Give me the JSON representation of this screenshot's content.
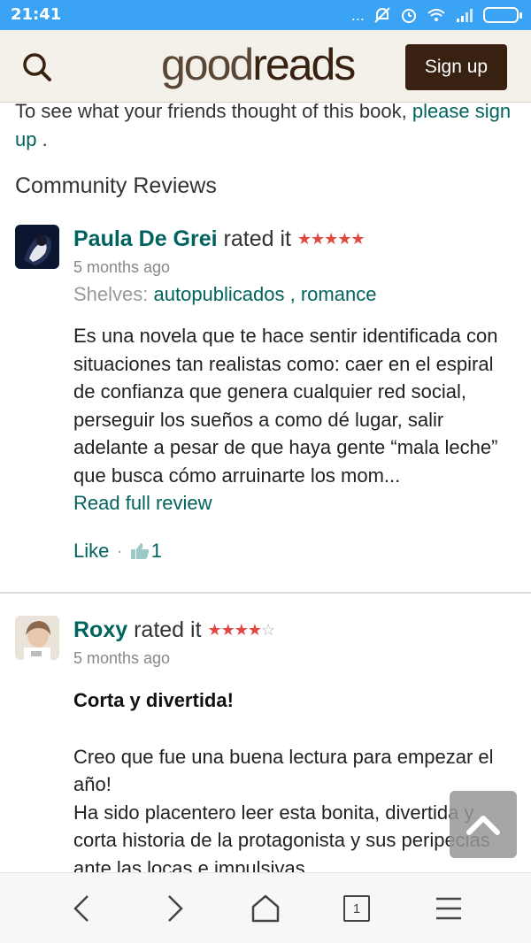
{
  "status_bar": {
    "time": "21:41",
    "dots": "..."
  },
  "header": {
    "logo_light": "good",
    "logo_bold": "reads",
    "signup_label": "Sign up"
  },
  "intro": {
    "text": "To see what your friends thought of this book, ",
    "link": "please sign up",
    "end": " ."
  },
  "section_title": "Community Reviews",
  "reviews": [
    {
      "name": "Paula De Grei",
      "rated": " rated it ",
      "rating": 5,
      "stars_full": "★★★★★",
      "stars_empty": "",
      "ago": "5 months ago",
      "shelves_label": "Shelves: ",
      "shelves": [
        "autopublicados",
        "romance"
      ],
      "shelves_sep": " , ",
      "text": "Es una novela que te hace sentir identificada con situaciones tan realistas como: caer en el espiral de confianza que genera cualquier red social, perseguir los sueños a como dé lugar, salir adelante a pesar de que haya gente “mala leche” que busca cómo arruinarte los mom...",
      "read_full": "Read full review",
      "like_label": "Like",
      "like_sep": "·",
      "like_count": "1"
    },
    {
      "name": "Roxy",
      "rated": " rated it ",
      "rating": 4,
      "stars_full": "★★★★",
      "stars_empty": "☆",
      "ago": "5 months ago",
      "headline": "Corta y divertida!",
      "text": "Creo que fue una buena lectura para empezar el año!\nHa sido placentero leer esta bonita, divertida y corta historia de la protagonista y sus peripecias ante las locas e impulsivas"
    }
  ],
  "bottom_nav": {
    "tabs_count": "1"
  }
}
